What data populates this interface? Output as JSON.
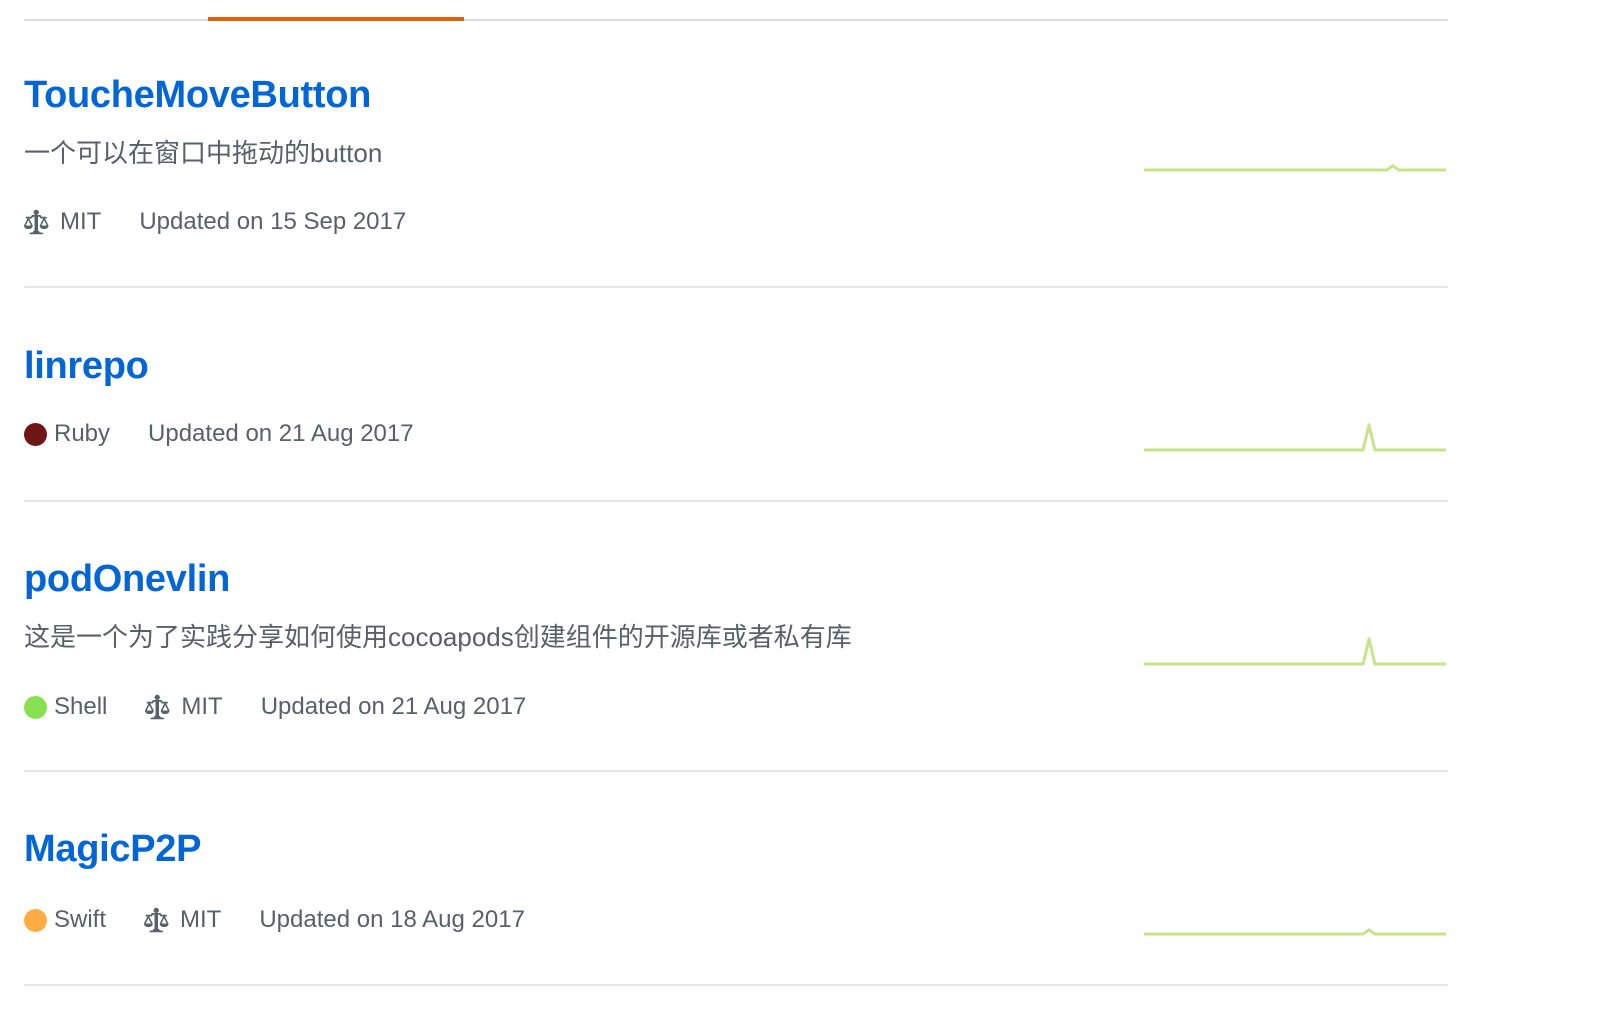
{
  "accent_color": "#e36209",
  "link_color": "#0366d6",
  "sparkline_color": "#c6e48b",
  "repos": [
    {
      "name": "ToucheMoveButton",
      "description": "一个可以在窗口中拖动的button",
      "language": null,
      "license": "MIT",
      "updated": "Updated on 15 Sep 2017",
      "activity": [
        0,
        0,
        0,
        0,
        0,
        0,
        0,
        0,
        0,
        0,
        0,
        0,
        0,
        0,
        0,
        0,
        0,
        0,
        0,
        0,
        0,
        0,
        0,
        0,
        0,
        0,
        0,
        0,
        0,
        0,
        0,
        0,
        0,
        0,
        0,
        0,
        0,
        0,
        0,
        0,
        0,
        0,
        1,
        0,
        0,
        0,
        0,
        0,
        0,
        0,
        0,
        0
      ]
    },
    {
      "name": "linrepo",
      "description": "",
      "language": {
        "name": "Ruby",
        "color": "#701516"
      },
      "license": null,
      "updated": "Updated on 21 Aug 2017",
      "activity": [
        0,
        0,
        0,
        0,
        0,
        0,
        0,
        0,
        0,
        0,
        0,
        0,
        0,
        0,
        0,
        0,
        0,
        0,
        0,
        0,
        0,
        0,
        0,
        0,
        0,
        0,
        0,
        0,
        0,
        0,
        0,
        0,
        0,
        0,
        0,
        0,
        0,
        0,
        6,
        0,
        0,
        0,
        0,
        0,
        0,
        0,
        0,
        0,
        0,
        0,
        0,
        0
      ]
    },
    {
      "name": "podOnevlin",
      "description": "这是一个为了实践分享如何使用cocoapods创建组件的开源库或者私有库",
      "language": {
        "name": "Shell",
        "color": "#89e051"
      },
      "license": "MIT",
      "updated": "Updated on 21 Aug 2017",
      "activity": [
        0,
        0,
        0,
        0,
        0,
        0,
        0,
        0,
        0,
        0,
        0,
        0,
        0,
        0,
        0,
        0,
        0,
        0,
        0,
        0,
        0,
        0,
        0,
        0,
        0,
        0,
        0,
        0,
        0,
        0,
        0,
        0,
        0,
        0,
        0,
        0,
        0,
        0,
        6,
        0,
        0,
        0,
        0,
        0,
        0,
        0,
        0,
        0,
        0,
        0,
        0,
        0
      ]
    },
    {
      "name": "MagicP2P",
      "description": "",
      "language": {
        "name": "Swift",
        "color": "#ffac45"
      },
      "license": "MIT",
      "updated": "Updated on 18 Aug 2017",
      "activity": [
        0,
        0,
        0,
        0,
        0,
        0,
        0,
        0,
        0,
        0,
        0,
        0,
        0,
        0,
        0,
        0,
        0,
        0,
        0,
        0,
        0,
        0,
        0,
        0,
        0,
        0,
        0,
        0,
        0,
        0,
        0,
        0,
        0,
        0,
        0,
        0,
        0,
        0,
        1,
        0,
        0,
        0,
        0,
        0,
        0,
        0,
        0,
        0,
        0,
        0,
        0,
        0
      ]
    }
  ]
}
